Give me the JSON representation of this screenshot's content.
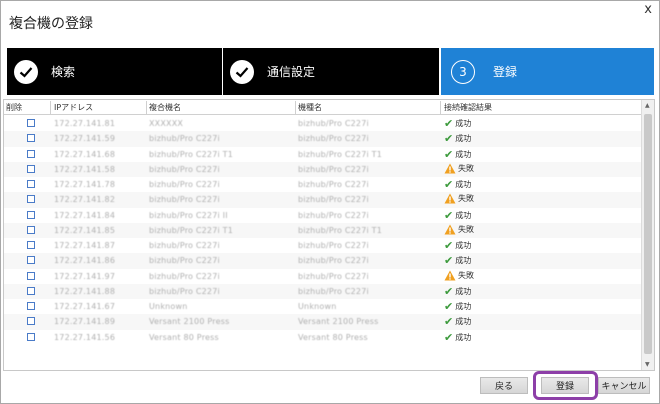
{
  "dialog": {
    "title": "複合機の登録",
    "close_label": "x"
  },
  "steps": [
    {
      "label": "検索",
      "status": "done"
    },
    {
      "label": "通信設定",
      "status": "done"
    },
    {
      "label": "登録",
      "number": "3",
      "status": "active"
    }
  ],
  "colors": {
    "step_done_bg": "#000000",
    "step_active_bg": "#1f82d6",
    "success": "#3c9a3c",
    "warning": "#f0a020",
    "highlight": "#8d3fa8"
  },
  "table": {
    "headers": {
      "delete": "削除",
      "ip": "IPアドレス",
      "mfp_name": "複合機名",
      "model": "機種名",
      "result": "接続確認結果"
    },
    "rows": [
      {
        "ip": "172.27.141.81",
        "name": "XXXXXX",
        "model": "bizhub/Pro C227i",
        "result": "成功",
        "status": "ok"
      },
      {
        "ip": "172.27.141.59",
        "name": "bizhub/Pro C227i",
        "model": "bizhub/Pro C227i",
        "result": "成功",
        "status": "ok"
      },
      {
        "ip": "172.27.141.68",
        "name": "bizhub/Pro C227i T1",
        "model": "bizhub/Pro C227i T1",
        "result": "成功",
        "status": "ok"
      },
      {
        "ip": "172.27.141.58",
        "name": "bizhub/Pro C227i",
        "model": "bizhub/Pro C227i",
        "result": "失敗",
        "status": "warn"
      },
      {
        "ip": "172.27.141.78",
        "name": "bizhub/Pro C227i",
        "model": "bizhub/Pro C227i",
        "result": "成功",
        "status": "ok"
      },
      {
        "ip": "172.27.141.82",
        "name": "bizhub/Pro C227i",
        "model": "bizhub/Pro C227i",
        "result": "失敗",
        "status": "warn"
      },
      {
        "ip": "172.27.141.84",
        "name": "bizhub/Pro C227i II",
        "model": "bizhub/Pro C227i",
        "result": "成功",
        "status": "ok"
      },
      {
        "ip": "172.27.141.85",
        "name": "bizhub/Pro C227i T1",
        "model": "bizhub/Pro C227i T1",
        "result": "失敗",
        "status": "warn"
      },
      {
        "ip": "172.27.141.87",
        "name": "bizhub/Pro C227i",
        "model": "bizhub/Pro C227i",
        "result": "成功",
        "status": "ok"
      },
      {
        "ip": "172.27.141.86",
        "name": "bizhub/Pro C227i",
        "model": "bizhub/Pro C227i",
        "result": "成功",
        "status": "ok"
      },
      {
        "ip": "172.27.141.97",
        "name": "bizhub/Pro C227i",
        "model": "bizhub/Pro C227i",
        "result": "失敗",
        "status": "warn"
      },
      {
        "ip": "172.27.141.88",
        "name": "bizhub/Pro C227i",
        "model": "bizhub/Pro C227i",
        "result": "成功",
        "status": "ok"
      },
      {
        "ip": "172.27.141.67",
        "name": "Unknown",
        "model": "Unknown",
        "result": "成功",
        "status": "ok"
      },
      {
        "ip": "172.27.141.89",
        "name": "Versant 2100 Press",
        "model": "Versant 2100 Press",
        "result": "成功",
        "status": "ok"
      },
      {
        "ip": "172.27.141.56",
        "name": "Versant 80 Press",
        "model": "Versant 80 Press",
        "result": "成功",
        "status": "ok"
      }
    ]
  },
  "buttons": {
    "back": "戻る",
    "register": "登録",
    "cancel": "キャンセル"
  }
}
